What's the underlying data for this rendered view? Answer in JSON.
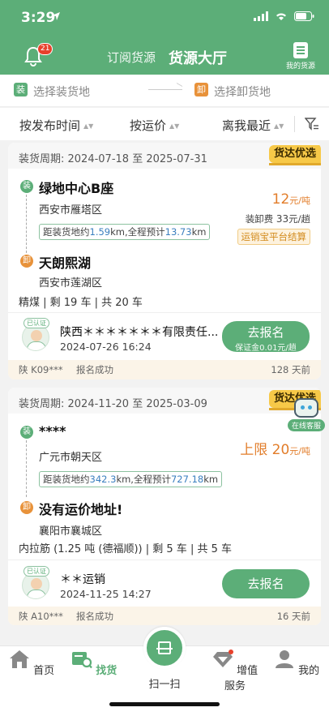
{
  "status": {
    "time": "3:29"
  },
  "header": {
    "notify_count": "21",
    "tab_subscribe": "订阅货源",
    "tab_market": "货源大厅",
    "my_sources": "我的货源"
  },
  "route": {
    "load_tag": "装",
    "load_placeholder": "选择装货地",
    "unload_tag": "卸",
    "unload_placeholder": "选择卸货地"
  },
  "sort": {
    "by_time": "按发布时间",
    "by_price": "按运价",
    "by_distance": "离我最近"
  },
  "cards": [
    {
      "period": "装货周期: 2024-07-18 至 2025-07-31",
      "tag": "货达优选",
      "load_mark": "装",
      "unload_mark": "卸",
      "load_name": "绿地中心B座",
      "load_district": "西安市雁塔区",
      "dist_prefix": "距装货地约",
      "dist_value": "1.59",
      "dist_middle": "km,全程预计",
      "dist_total": "13.73",
      "dist_suffix": "km",
      "price_prefix": "",
      "price": "12",
      "price_unit": "元/吨",
      "fee_label": "装卸费",
      "fee_value": "33",
      "fee_unit": "元/趟",
      "settle": "运销宝平台结算",
      "unload_name": "天朗熙湖",
      "unload_district": "西安市莲湖区",
      "goods": "精煤 | 剩 19 车 | 共 20 车",
      "verified": "已认证",
      "company": "陕西＊＊＊＊＊＊＊有限责任...",
      "time": "2024-07-26 16:24",
      "button": "去报名",
      "button_sub": "保证金0.01元/趟",
      "plate": "陕 K09***",
      "signup_status": "报名成功",
      "ago": "128 天前"
    },
    {
      "period": "装货周期: 2024-11-20 至 2025-03-09",
      "tag": "货达优选",
      "load_mark": "装",
      "unload_mark": "卸",
      "load_name": "****",
      "load_district": "广元市朝天区",
      "dist_prefix": "距装货地约",
      "dist_value": "342.3",
      "dist_middle": "km,全程预计",
      "dist_total": "727.18",
      "dist_suffix": "km",
      "price_prefix": "上限",
      "price": "20",
      "price_unit": "元/吨",
      "unload_name": "没有运价地址!",
      "unload_district": "襄阳市襄城区",
      "goods": "内拉筋 (1.25 吨 (德福顺)) | 剩 5 车 | 共 5 车",
      "verified": "已认证",
      "company": "＊＊运销",
      "time": "2024-11-25 14:27",
      "button": "去报名",
      "plate": "陕 A10***",
      "signup_status": "报名成功",
      "ago": "16 天前"
    }
  ],
  "kefu": {
    "label": "在线客服"
  },
  "tabbar": {
    "home": "首页",
    "find_goods": "找货",
    "scan": "扫一扫",
    "value_added": "增值服务",
    "mine": "我的"
  },
  "colors": {
    "brand_green": "#5cae78",
    "orange": "#e27d2a",
    "tag_yellow": "#f7c948"
  }
}
